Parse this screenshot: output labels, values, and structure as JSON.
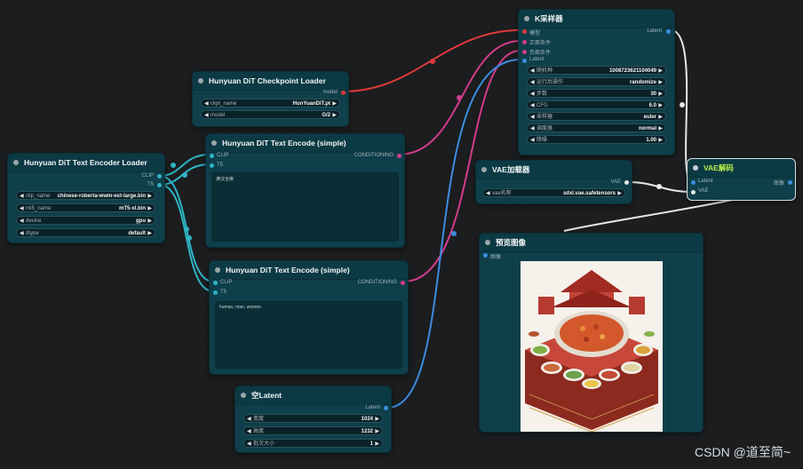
{
  "watermark": "CSDN @道至简~",
  "colors": {
    "canvas_bg": "#1b1d1f",
    "node_bg": "#0e3f4a",
    "model_wire": "#e03a3a",
    "conditioning_wire": "#d23c8a",
    "clip_wire": "#2fb4c4",
    "latent_wire": "#3b8de0",
    "vae_wire": "#e8e8e8"
  },
  "nodes": {
    "ksampler": {
      "title": "K采样器",
      "inputs": [
        "模型",
        "正面条件",
        "负面条件",
        "Latent"
      ],
      "output": "Latent",
      "widgets": [
        {
          "label": "随机种",
          "value": "1008723621104049"
        },
        {
          "label": "运行后操作",
          "value": "randomize"
        },
        {
          "label": "步数",
          "value": "30"
        },
        {
          "label": "CFG",
          "value": "6.0"
        },
        {
          "label": "采样器",
          "value": "euler"
        },
        {
          "label": "调度器",
          "value": "normal"
        },
        {
          "label": "降噪",
          "value": "1.00"
        }
      ]
    },
    "checkpoint_loader": {
      "title": "Hunyuan DiT Checkpoint Loader",
      "output": "model",
      "widgets": [
        {
          "label": "ckpt_name",
          "value": "HunYuanDiT.pt"
        },
        {
          "label": "model",
          "value": "G/2"
        }
      ]
    },
    "text_encoder_loader": {
      "title": "Hunyuan DiT Text Encoder Loader",
      "outputs": [
        "CLIP",
        "T5"
      ],
      "widgets": [
        {
          "label": "clip_name",
          "value": "chinese-roberta-wwm-ext-large.bin"
        },
        {
          "label": "mt5_name",
          "value": "mT5-xl.bin"
        },
        {
          "label": "device",
          "value": "gpu"
        },
        {
          "label": "dtype",
          "value": "default"
        }
      ]
    },
    "text_encode_pos": {
      "title": "Hunyuan DiT Text Encode (simple)",
      "inputs": [
        "CLIP",
        "T5"
      ],
      "output": "CONDITIONING",
      "text": "满汉全席"
    },
    "text_encode_neg": {
      "title": "Hunyuan DiT Text Encode (simple)",
      "inputs": [
        "CLIP",
        "T5"
      ],
      "output": "CONDITIONING",
      "text": "human, man, women"
    },
    "vae_loader": {
      "title": "VAE加载器",
      "output": "VAE",
      "widgets": [
        {
          "label": "vae名称",
          "value": "sdxl.vae.safetensors"
        }
      ]
    },
    "vae_decode": {
      "title": "VAE解码",
      "inputs": [
        "Latent",
        "VAE"
      ],
      "output": "图像"
    },
    "preview_image": {
      "title": "预览图像",
      "inputs": [
        "图像"
      ]
    },
    "empty_latent": {
      "title": "空Latent",
      "output": "Latent",
      "widgets": [
        {
          "label": "宽度",
          "value": "1024"
        },
        {
          "label": "高度",
          "value": "1232"
        },
        {
          "label": "批次大小",
          "value": "1"
        }
      ]
    }
  }
}
